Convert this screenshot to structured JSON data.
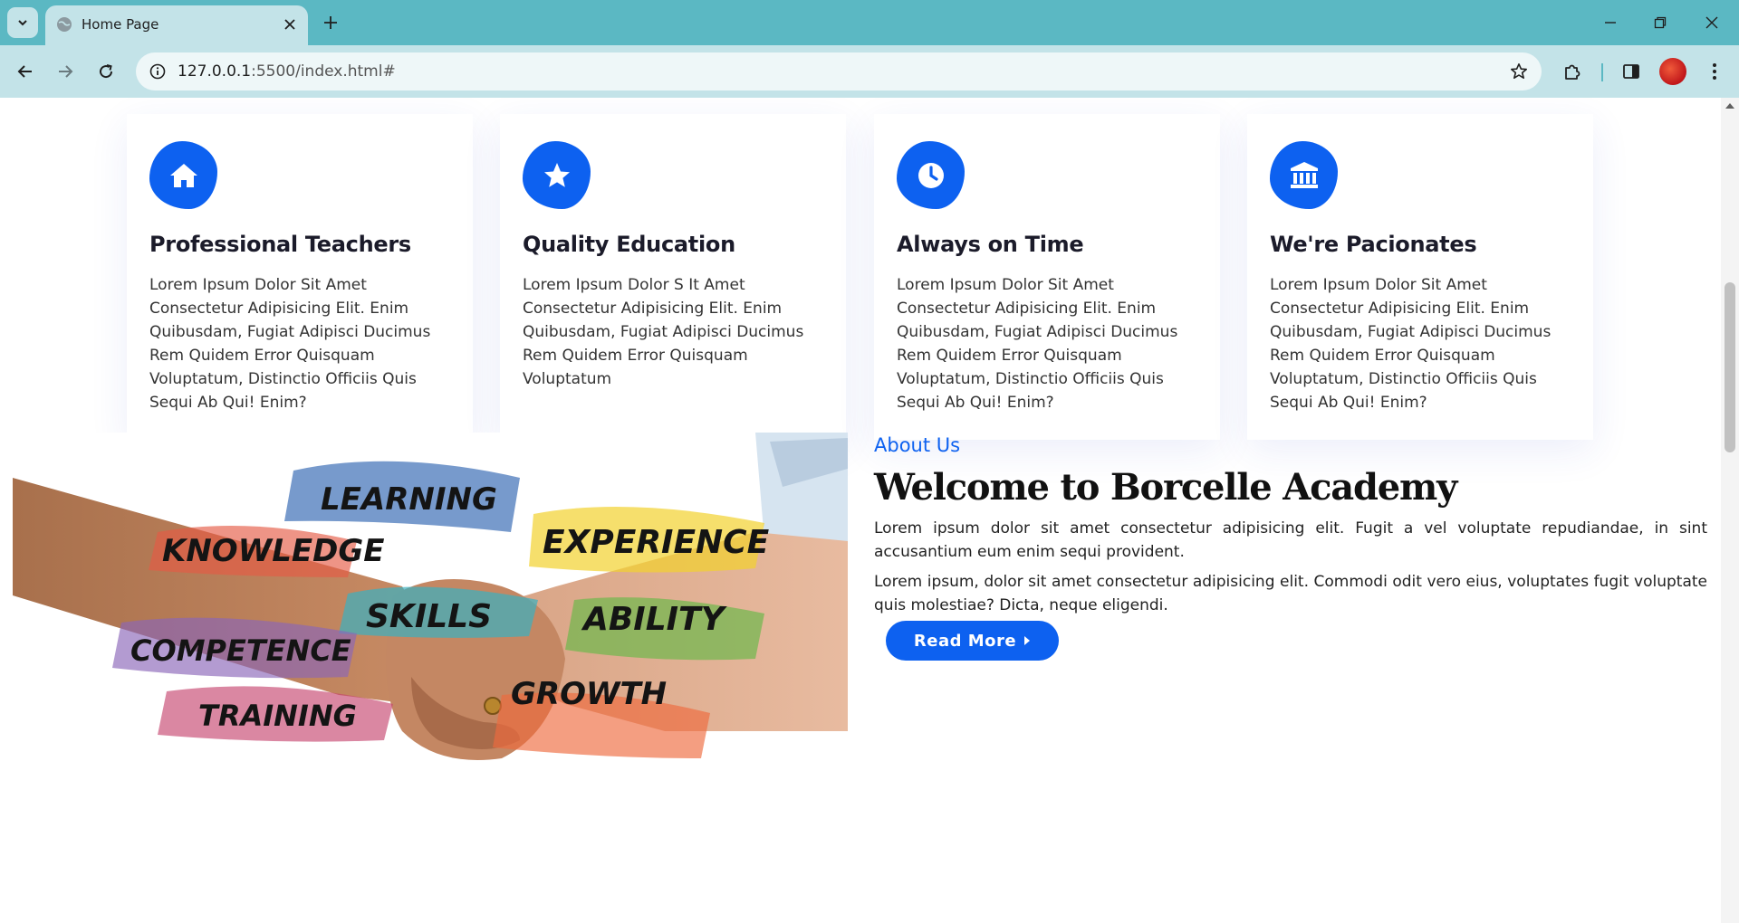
{
  "browser": {
    "tab_title": "Home Page",
    "url_host": "127.0.0.1",
    "url_path": ":5500/index.html#"
  },
  "features": [
    {
      "icon": "home-icon",
      "title": "Professional Teachers",
      "text": "Lorem Ipsum Dolor Sit Amet Consectetur Adipisicing Elit. Enim Quibusdam, Fugiat Adipisci Ducimus Rem Quidem Error Quisquam Voluptatum, Distinctio Officiis Quis Sequi Ab Qui! Enim?"
    },
    {
      "icon": "star-icon",
      "title": "Quality Education",
      "text": "Lorem Ipsum Dolor S It Amet Consectetur Adipisicing Elit. Enim Quibusdam, Fugiat Adipisci Ducimus Rem Quidem Error Quisquam Voluptatum"
    },
    {
      "icon": "clock-icon",
      "title": "Always on Time",
      "text": "Lorem Ipsum Dolor Sit Amet Consectetur Adipisicing Elit. Enim Quibusdam, Fugiat Adipisci Ducimus Rem Quidem Error Quisquam Voluptatum, Distinctio Officiis Quis Sequi Ab Qui! Enim?"
    },
    {
      "icon": "bank-icon",
      "title": "We're Pacionates",
      "text": "Lorem Ipsum Dolor Sit Amet Consectetur Adipisicing Elit. Enim Quibusdam, Fugiat Adipisci Ducimus Rem Quidem Error Quisquam Voluptatum, Distinctio Officiis Quis Sequi Ab Qui! Enim?"
    }
  ],
  "about": {
    "kicker": "About Us",
    "title": "Welcome to Borcelle Academy",
    "p1": "Lorem ipsum dolor sit amet consectetur adipisicing elit. Fugit a vel voluptate repudiandae, in sint accusantium eum enim sequi provident.",
    "p2": "Lorem ipsum, dolor sit amet consectetur adipisicing elit. Commodi odit vero eius, voluptates fugit voluptate quis molestiae? Dicta, neque eligendi.",
    "button": "Read More",
    "image_words": [
      "LEARNING",
      "KNOWLEDGE",
      "EXPERIENCE",
      "SKILLS",
      "ABILITY",
      "COMPETENCE",
      "TRAINING",
      "GROWTH"
    ]
  },
  "colors": {
    "accent": "#0d61f0",
    "chrome": "#5bb8c3",
    "chrome_light": "#c3e3e8"
  }
}
